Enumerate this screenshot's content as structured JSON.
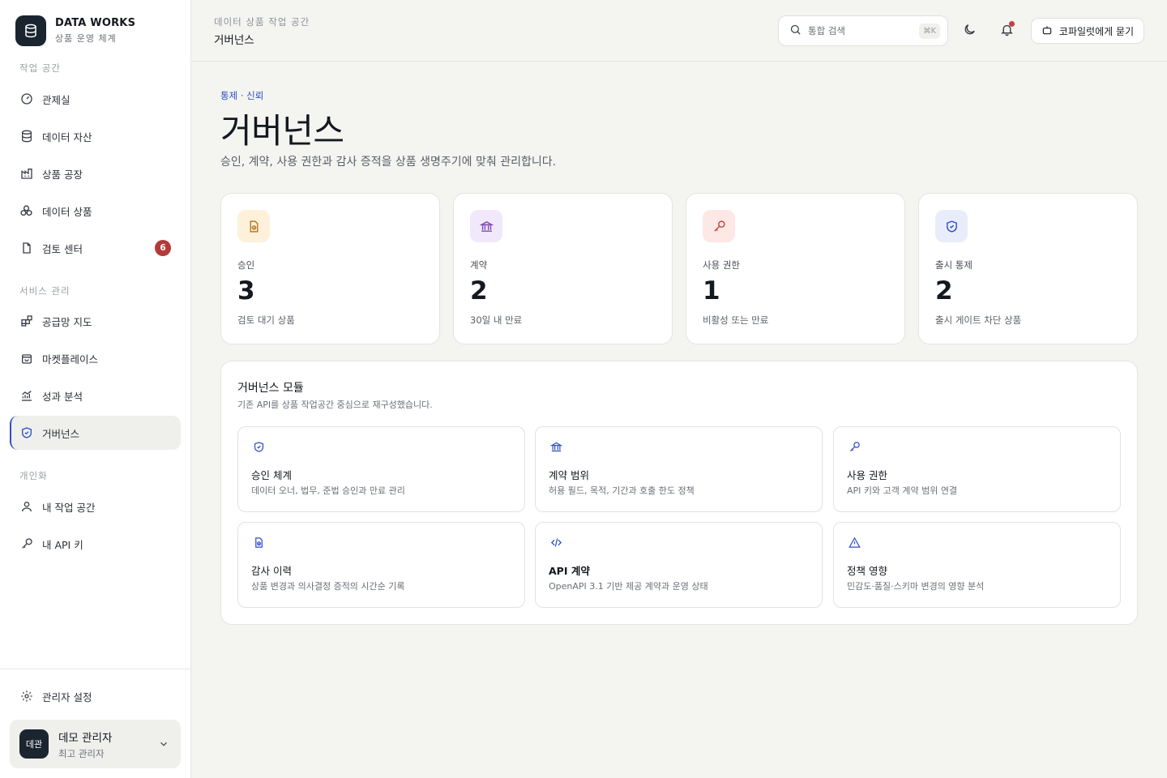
{
  "brand": {
    "title": "DATA WORKS",
    "subtitle": "상품 운영 체계",
    "logo_icon": "database-icon"
  },
  "sidebar": {
    "sections": [
      {
        "label": "작업 공간"
      },
      {
        "label": "서비스 관리"
      },
      {
        "label": "개인화"
      }
    ],
    "items": [
      {
        "label": "관제실",
        "icon": "gauge-icon"
      },
      {
        "label": "데이터 자산",
        "icon": "database-icon"
      },
      {
        "label": "상품 공장",
        "icon": "factory-icon"
      },
      {
        "label": "데이터 상품",
        "icon": "boxes-icon"
      },
      {
        "label": "검토 센터",
        "icon": "file-icon",
        "badge": "6"
      },
      {
        "label": "공급망 지도",
        "icon": "grid-plus-icon"
      },
      {
        "label": "마켓플레이스",
        "icon": "bag-icon"
      },
      {
        "label": "성과 분석",
        "icon": "chart-icon"
      },
      {
        "label": "거버넌스",
        "icon": "shield-icon",
        "active": true
      },
      {
        "label": "내 작업 공간",
        "icon": "user-icon"
      },
      {
        "label": "내 API 키",
        "icon": "key-icon"
      }
    ],
    "settings_label": "관리자 설정",
    "user": {
      "avatar": "데관",
      "name": "데모 관리자",
      "role": "최고 관리자"
    }
  },
  "header": {
    "breadcrumb_sub": "데이터 상품 작업 공간",
    "breadcrumb_title": "거버넌스",
    "search_placeholder": "통합 검색",
    "search_shortcut": "⌘K",
    "copilot_label": "코파일럿에게 묻기"
  },
  "page": {
    "eyebrow": "통제 · 신뢰",
    "title": "거버넌스",
    "description": "승인, 계약, 사용 권한과 감사 증적을 상품 생명주기에 맞춰 관리합니다."
  },
  "stats": [
    {
      "label": "승인",
      "value": "3",
      "note": "검토 대기 상품",
      "icon": "audit-icon",
      "accent": "#b7791f",
      "bg": "#fdf1dc"
    },
    {
      "label": "계약",
      "value": "2",
      "note": "30일 내 만료",
      "icon": "bank-icon",
      "accent": "#7b4bb7",
      "bg": "#f1e8fb"
    },
    {
      "label": "사용 권한",
      "value": "1",
      "note": "비활성 또는 만료",
      "icon": "key-icon",
      "accent": "#c0453b",
      "bg": "#fde8e6"
    },
    {
      "label": "출시 통제",
      "value": "2",
      "note": "출시 게이트 차단 상품",
      "icon": "shield-icon",
      "accent": "#2f4fc6",
      "bg": "#e9edfb"
    }
  ],
  "modules": {
    "title": "거버넌스 모듈",
    "subtitle": "기존 API를 상품 작업공간 중심으로 재구성했습니다.",
    "items": [
      {
        "name": "승인 체계",
        "desc": "데이터 오너, 법무, 준법 승인과 만료 관리",
        "icon": "shield-icon"
      },
      {
        "name": "계약 범위",
        "desc": "허용 필드, 목적, 기간과 호출 한도 정책",
        "icon": "bank-icon"
      },
      {
        "name": "사용 권한",
        "desc": "API 키와 고객 계약 범위 연결",
        "icon": "key-icon"
      },
      {
        "name": "감사 이력",
        "desc": "상품 변경과 의사결정 증적의 시간순 기록",
        "icon": "audit-icon"
      },
      {
        "name": "API 계약",
        "desc": "OpenAPI 3.1 기반 제공 계약과 운영 상태",
        "icon": "code-icon"
      },
      {
        "name": "정책 영향",
        "desc": "민감도·품질·스키마 변경의 영향 분석",
        "icon": "warning-icon"
      }
    ]
  },
  "colors": {
    "accent": "#2f4fc6",
    "danger": "#b33a3a",
    "dark": "#1b2530"
  }
}
